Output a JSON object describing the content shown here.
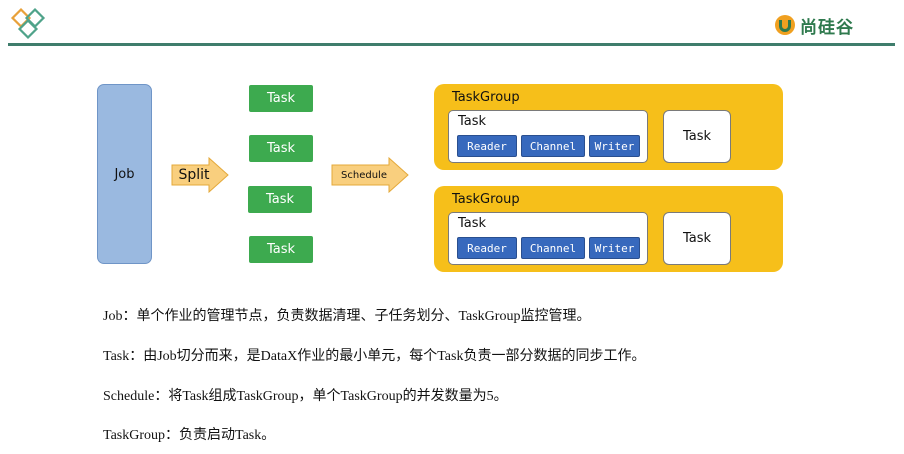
{
  "brand": {
    "name": "尚硅谷"
  },
  "diagram": {
    "job_label": "Job",
    "split_label": "Split",
    "schedule_label": "Schedule",
    "tasks": [
      "Task",
      "Task",
      "Task",
      "Task"
    ],
    "groups": [
      {
        "title": "TaskGroup",
        "inner_title": "Task",
        "components": [
          "Reader",
          "Channel",
          "Writer"
        ],
        "side_task": "Task"
      },
      {
        "title": "TaskGroup",
        "inner_title": "Task",
        "components": [
          "Reader",
          "Channel",
          "Writer"
        ],
        "side_task": "Task"
      }
    ],
    "colors": {
      "job": "#9ab9e0",
      "task": "#3daa4f",
      "arrow": "#f9cf7e",
      "group": "#f6bf1a",
      "component": "#3769bd"
    }
  },
  "descriptions": [
    "Job：单个作业的管理节点，负责数据清理、子任务划分、TaskGroup监控管理。",
    "Task：由Job切分而来，是DataX作业的最小单元，每个Task负责一部分数据的同步工作。",
    "Schedule：将Task组成TaskGroup，单个TaskGroup的并发数量为5。",
    "TaskGroup：负责启动Task。"
  ]
}
